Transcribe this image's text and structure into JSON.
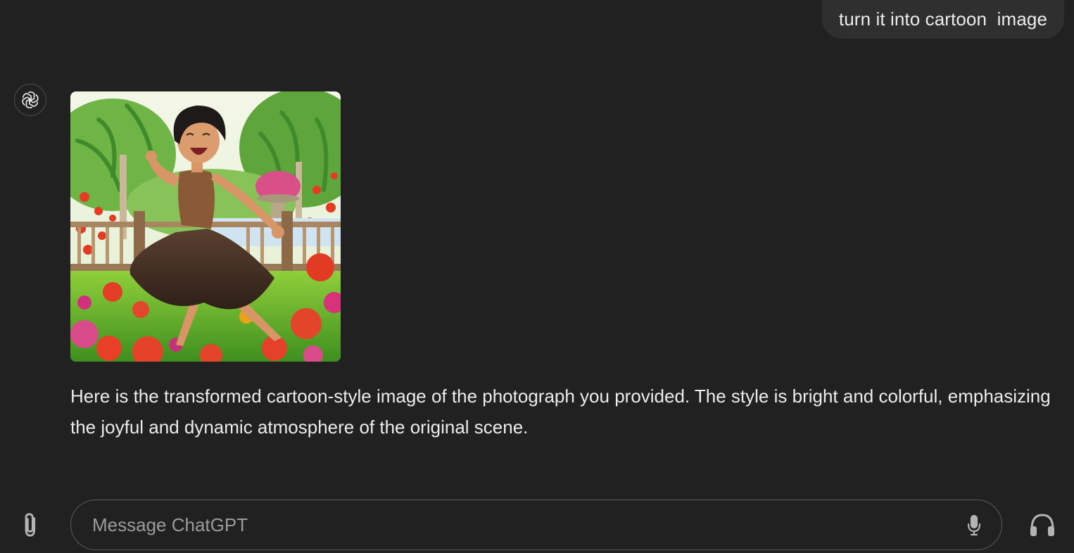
{
  "conversation": {
    "user_message": "turn it into cartoon  image",
    "assistant": {
      "avatar_icon": "openai-logo-icon",
      "image_alt": "Cartoon-style woman dancing joyfully in a flower garden",
      "response": "Here is the transformed cartoon-style image of the photograph you provided. The style is bright and colorful, emphasizing the joyful and dynamic atmosphere of the original scene."
    }
  },
  "composer": {
    "placeholder": "Message ChatGPT",
    "attach_icon": "paperclip-icon",
    "mic_icon": "microphone-icon",
    "voice_icon": "headphones-icon"
  },
  "colors": {
    "background": "#212121",
    "bubble": "#2f2f2f",
    "text": "#ececec",
    "placeholder": "#9b9b9b",
    "border": "#5a5a5a"
  }
}
